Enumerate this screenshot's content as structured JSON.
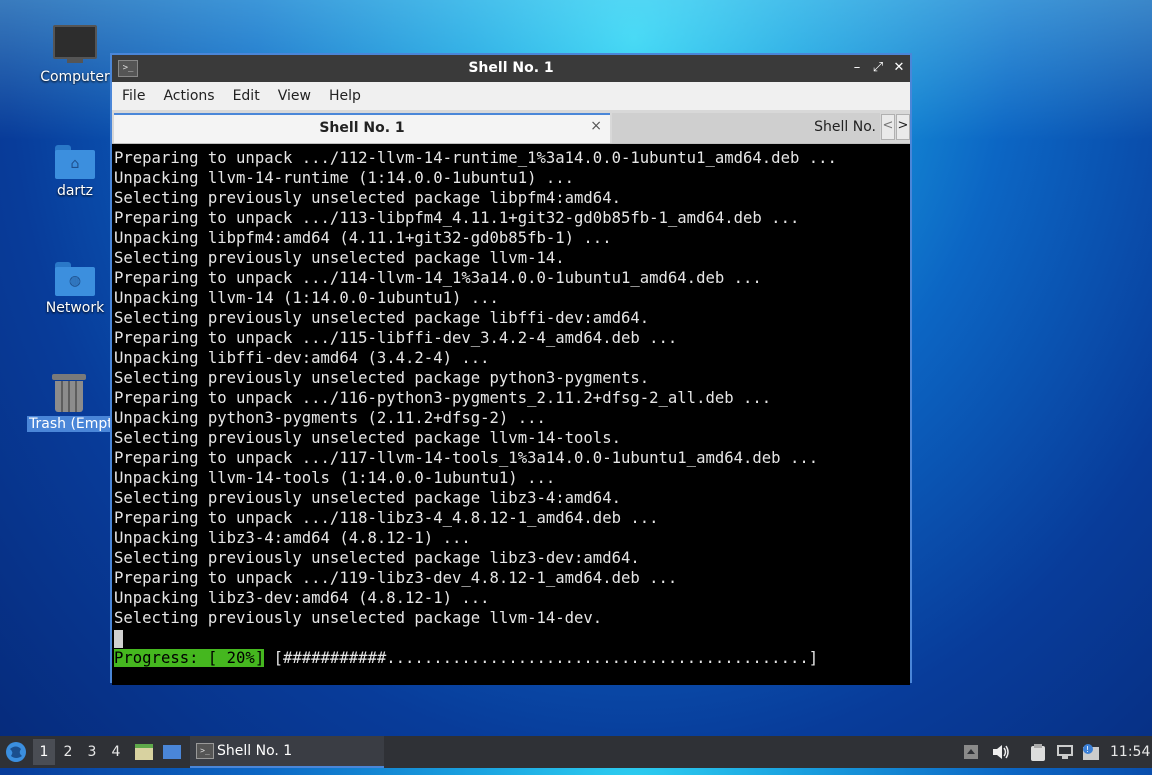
{
  "desktop": {
    "icons": [
      {
        "label": "Computer",
        "icon": "computer-icon"
      },
      {
        "label": "dartz",
        "icon": "home-folder-icon"
      },
      {
        "label": "Network",
        "icon": "network-folder-icon"
      },
      {
        "label": "Trash (Empt",
        "icon": "trash-icon"
      }
    ]
  },
  "window": {
    "title": "Shell No. 1",
    "menu": [
      "File",
      "Actions",
      "Edit",
      "View",
      "Help"
    ],
    "tabs": [
      {
        "label": "Shell No. 1",
        "active": true
      },
      {
        "label": "Shell No.",
        "active": false
      }
    ],
    "tab_close_glyph": "×",
    "tab_prev_glyph": "<",
    "tab_next_glyph": ">",
    "controls": {
      "minimize": "–",
      "maximize": "⤢",
      "close": "✕"
    }
  },
  "terminal": {
    "lines": [
      "Preparing to unpack .../112-llvm-14-runtime_1%3a14.0.0-1ubuntu1_amd64.deb ...",
      "Unpacking llvm-14-runtime (1:14.0.0-1ubuntu1) ...",
      "Selecting previously unselected package libpfm4:amd64.",
      "Preparing to unpack .../113-libpfm4_4.11.1+git32-gd0b85fb-1_amd64.deb ...",
      "Unpacking libpfm4:amd64 (4.11.1+git32-gd0b85fb-1) ...",
      "Selecting previously unselected package llvm-14.",
      "Preparing to unpack .../114-llvm-14_1%3a14.0.0-1ubuntu1_amd64.deb ...",
      "Unpacking llvm-14 (1:14.0.0-1ubuntu1) ...",
      "Selecting previously unselected package libffi-dev:amd64.",
      "Preparing to unpack .../115-libffi-dev_3.4.2-4_amd64.deb ...",
      "Unpacking libffi-dev:amd64 (3.4.2-4) ...",
      "Selecting previously unselected package python3-pygments.",
      "Preparing to unpack .../116-python3-pygments_2.11.2+dfsg-2_all.deb ...",
      "Unpacking python3-pygments (2.11.2+dfsg-2) ...",
      "Selecting previously unselected package llvm-14-tools.",
      "Preparing to unpack .../117-llvm-14-tools_1%3a14.0.0-1ubuntu1_amd64.deb ...",
      "Unpacking llvm-14-tools (1:14.0.0-1ubuntu1) ...",
      "Selecting previously unselected package libz3-4:amd64.",
      "Preparing to unpack .../118-libz3-4_4.8.12-1_amd64.deb ...",
      "Unpacking libz3-4:amd64 (4.8.12-1) ...",
      "Selecting previously unselected package libz3-dev:amd64.",
      "Preparing to unpack .../119-libz3-dev_4.8.12-1_amd64.deb ...",
      "Unpacking libz3-dev:amd64 (4.8.12-1) ...",
      "Selecting previously unselected package llvm-14-dev."
    ],
    "progress_label": "Progress: [ 20%]",
    "progress_bar": " [###########.............................................]",
    "progress_percent": 20
  },
  "taskbar": {
    "workspaces": [
      "1",
      "2",
      "3",
      "4"
    ],
    "active_workspace": "1",
    "task_label": "Shell No. 1",
    "clock": "11:54",
    "tray_icons": [
      "show-panel-icon",
      "volume-icon",
      "clipboard-icon",
      "network-icon",
      "update-notifier-icon"
    ]
  },
  "colors": {
    "accent": "#4a86d8",
    "progress_green": "#45b71f",
    "terminal_bg": "#000000",
    "taskbar_bg": "#2f3136"
  }
}
